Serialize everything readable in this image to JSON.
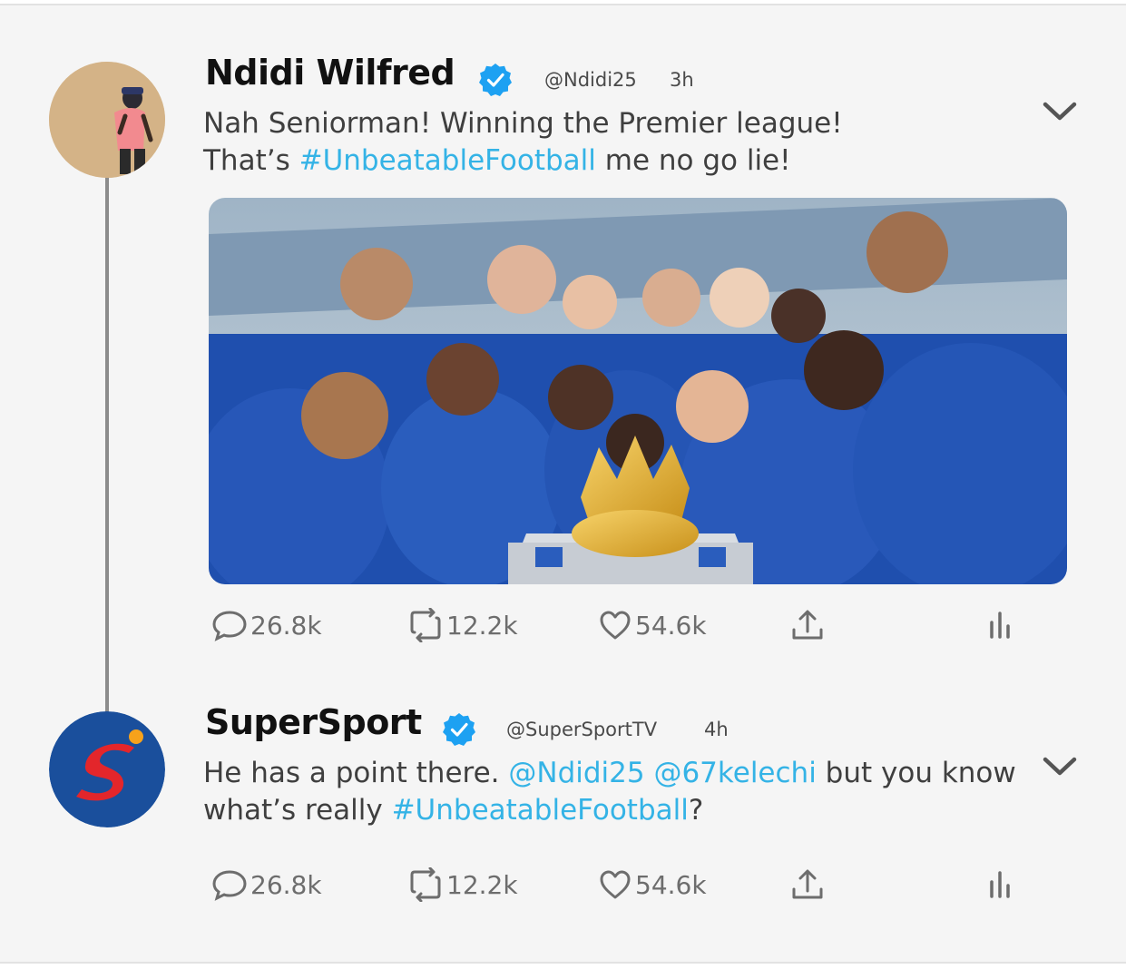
{
  "tweets": [
    {
      "author": "Ndidi Wilfred",
      "handle": "@Ndidi25",
      "time": "3h",
      "text_line1": "Nah Seniorman! Winning the Premier league!",
      "text_line2_pre": "That’s ",
      "text_line2_tag": "#UnbeatableFootball",
      "text_line2_post": " me no go lie!",
      "has_image": true,
      "stats": {
        "replies": "26.8k",
        "retweets": "12.2k",
        "likes": "54.6k"
      }
    },
    {
      "author": "SuperSport",
      "handle": "@SuperSportTV",
      "time": "4h",
      "text_line1_pre": "He has a point there. ",
      "mention1": "@Ndidi25",
      "mention2": "@67kelechi",
      "text_line1_post": " but you know",
      "text_line2_pre": "what’s really ",
      "text_line2_tag": "#UnbeatableFootball",
      "text_line2_post": "?",
      "stats": {
        "replies": "26.8k",
        "retweets": "12.2k",
        "likes": "54.6k"
      }
    }
  ],
  "icons": {
    "verified": "verified-badge-icon",
    "menu": "chevron-down-icon",
    "reply": "comment-bubble-icon",
    "retweet": "retweet-icon",
    "like": "heart-icon",
    "share": "share-icon",
    "analytics": "analytics-bars-icon"
  },
  "colors": {
    "accent": "#34b3e6",
    "verified": "#1da1f2",
    "background": "#f5f5f5",
    "thread_line": "#8c8c8c",
    "supersport_blue": "#1a4f9c",
    "supersport_red": "#e3262b"
  }
}
